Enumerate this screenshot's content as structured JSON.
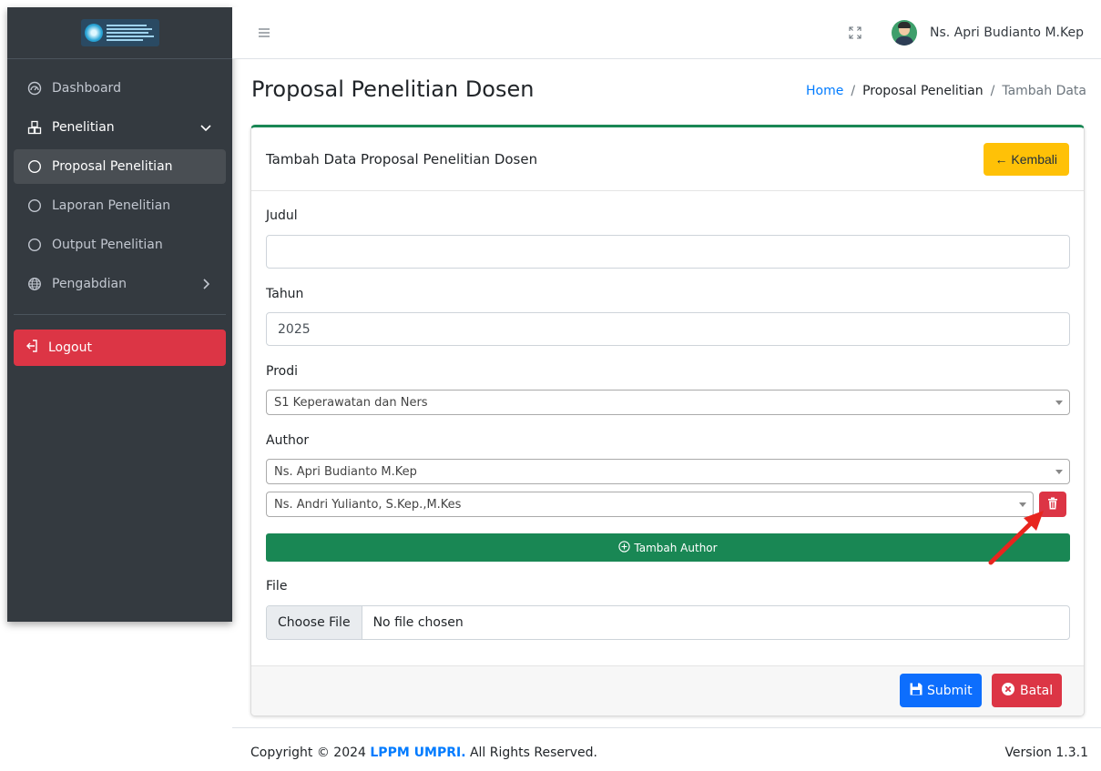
{
  "sidebar": {
    "items": [
      {
        "label": "Dashboard",
        "icon": "dashboard-icon"
      },
      {
        "label": "Penelitian",
        "icon": "cubes-icon",
        "expanded": true
      },
      {
        "label": "Proposal Penelitian",
        "icon": "circle-icon",
        "active": true
      },
      {
        "label": "Laporan Penelitian",
        "icon": "circle-icon"
      },
      {
        "label": "Output Penelitian",
        "icon": "circle-icon"
      },
      {
        "label": "Pengabdian",
        "icon": "globe-icon",
        "expanded": false
      }
    ],
    "logout_label": "Logout"
  },
  "topbar": {
    "user_name": "Ns. Apri Budianto M.Kep"
  },
  "page": {
    "title": "Proposal Penelitian Dosen",
    "breadcrumb": [
      "Home",
      "/",
      "Proposal Penelitian",
      "/",
      "Tambah Data"
    ]
  },
  "card": {
    "title": "Tambah Data Proposal Penelitian Dosen",
    "back_label": "← Kembali",
    "fields": {
      "judul_label": "Judul",
      "judul_value": "",
      "tahun_label": "Tahun",
      "tahun_value": "2025",
      "prodi_label": "Prodi",
      "prodi_value": "S1 Keperawatan dan Ners",
      "author_label": "Author",
      "authors": [
        "Ns. Apri Budianto M.Kep",
        "Ns. Andri Yulianto, S.Kep.,M.Kes"
      ],
      "add_author_label": "Tambah Author",
      "file_label": "File",
      "file_button": "Choose File",
      "file_status": "No file chosen"
    },
    "submit_label": "Submit",
    "cancel_label": "Batal"
  },
  "footer": {
    "copyright_prefix": "Copyright © 2024",
    "brand": "LPPM UMPRI.",
    "copyright_suffix": "All Rights Reserved.",
    "version": "Version 1.3.1"
  },
  "colors": {
    "sidebar_bg": "#343a40",
    "accent_green": "#198754",
    "warning": "#ffc107",
    "danger": "#dc3545",
    "primary": "#0d6efd"
  }
}
